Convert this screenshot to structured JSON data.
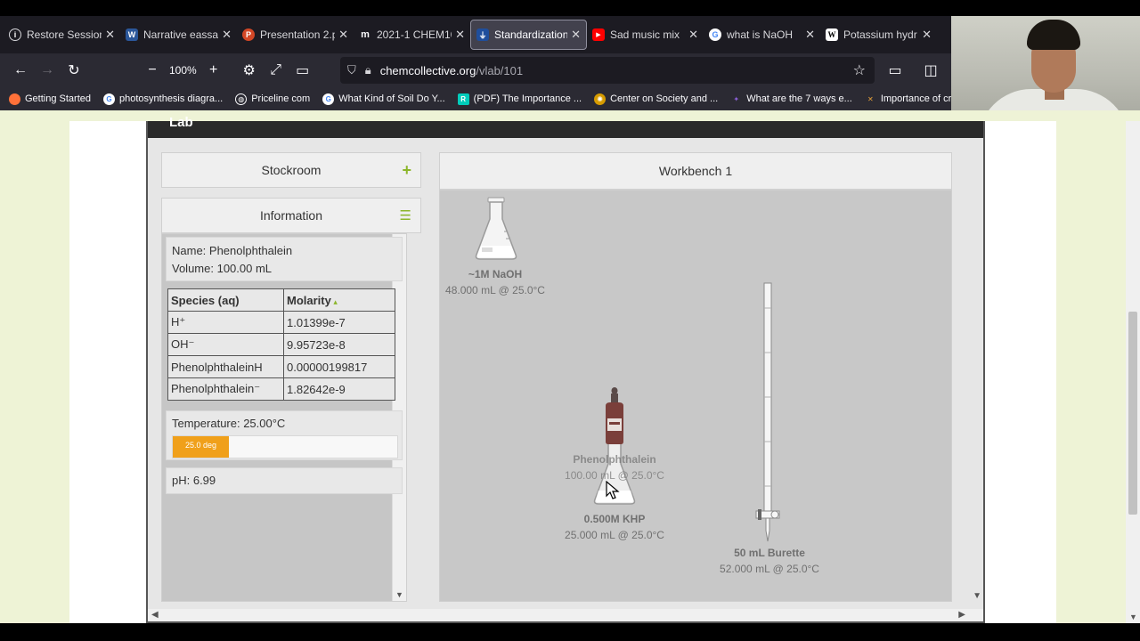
{
  "browser": {
    "tabs": [
      {
        "label": "Restore Session",
        "icon": "info-icon",
        "color": "#1c1b22"
      },
      {
        "label": "Narrative eassay",
        "icon": "word-icon",
        "color": "#2b579a"
      },
      {
        "label": "Presentation 2.p",
        "icon": "powerpoint-icon",
        "color": "#d24726"
      },
      {
        "label": "2021-1 CHEM10",
        "icon": "m-icon",
        "color": "#1c1b22"
      },
      {
        "label": "Standardization",
        "icon": "chemcollective-icon",
        "color": "#1f4e9c"
      },
      {
        "label": "Sad music mix",
        "icon": "youtube-icon",
        "color": "#ff0000"
      },
      {
        "label": "what is NaOH",
        "icon": "google-icon",
        "color": "#4285f4"
      },
      {
        "label": "Potassium hydr",
        "icon": "wikipedia-icon",
        "color": "#ffffff"
      }
    ],
    "zoom": "100%",
    "url_domain": "chemcollective.org",
    "url_path": "/vlab/101",
    "bookmarks": [
      {
        "label": "Getting Started",
        "icon": "firefox-icon",
        "color": "#ff7139"
      },
      {
        "label": "photosynthesis diagra...",
        "icon": "google-icon",
        "color": "#4285f4"
      },
      {
        "label": "Priceline com",
        "icon": "globe-icon",
        "color": "#2b2a33"
      },
      {
        "label": "What Kind of Soil Do Y...",
        "icon": "google-icon",
        "color": "#4285f4"
      },
      {
        "label": "(PDF) The Importance ...",
        "icon": "researchgate-icon",
        "color": "#00ccbb"
      },
      {
        "label": "Center on Society and ...",
        "icon": "center-icon",
        "color": "#d69b00"
      },
      {
        "label": "What are the 7 ways e...",
        "icon": "sparkle-icon",
        "color": "#8a5fd6"
      },
      {
        "label": "Importance of cr",
        "icon": "bolt-icon",
        "color": "#e8a33a"
      }
    ]
  },
  "lab": {
    "header": "Lab",
    "stockroom_label": "Stockroom",
    "information_label": "Information",
    "workbench_label": "Workbench 1",
    "info": {
      "name_line": "Name: Phenolphthalein",
      "volume_line": "Volume: 100.00 mL",
      "table_headers": [
        "Species (aq)",
        "Molarity"
      ],
      "rows": [
        {
          "species": "H⁺",
          "molarity": "1.01399e-7"
        },
        {
          "species": "OH⁻",
          "molarity": "9.95723e-8"
        },
        {
          "species": "PhenolphthaleinH",
          "molarity": "0.00000199817"
        },
        {
          "species": "Phenolphthalein⁻",
          "molarity": "1.82642e-9"
        }
      ],
      "temperature_line": "Temperature: 25.00°C",
      "temperature_bar_label": "25.0 deg",
      "temperature_fraction": 0.25,
      "ph_line": "pH: 6.99"
    },
    "bench_items": [
      {
        "name": "~1M NaOH",
        "detail": "48.000 mL @ 25.0°C"
      },
      {
        "name": "Phenolphthalein",
        "detail": "100.00 mL @ 25.0°C"
      },
      {
        "name": "0.500M KHP",
        "detail": "25.000 mL @ 25.0°C"
      },
      {
        "name": "50 mL Burette",
        "detail": "52.000 mL @ 25.0°C"
      }
    ]
  }
}
